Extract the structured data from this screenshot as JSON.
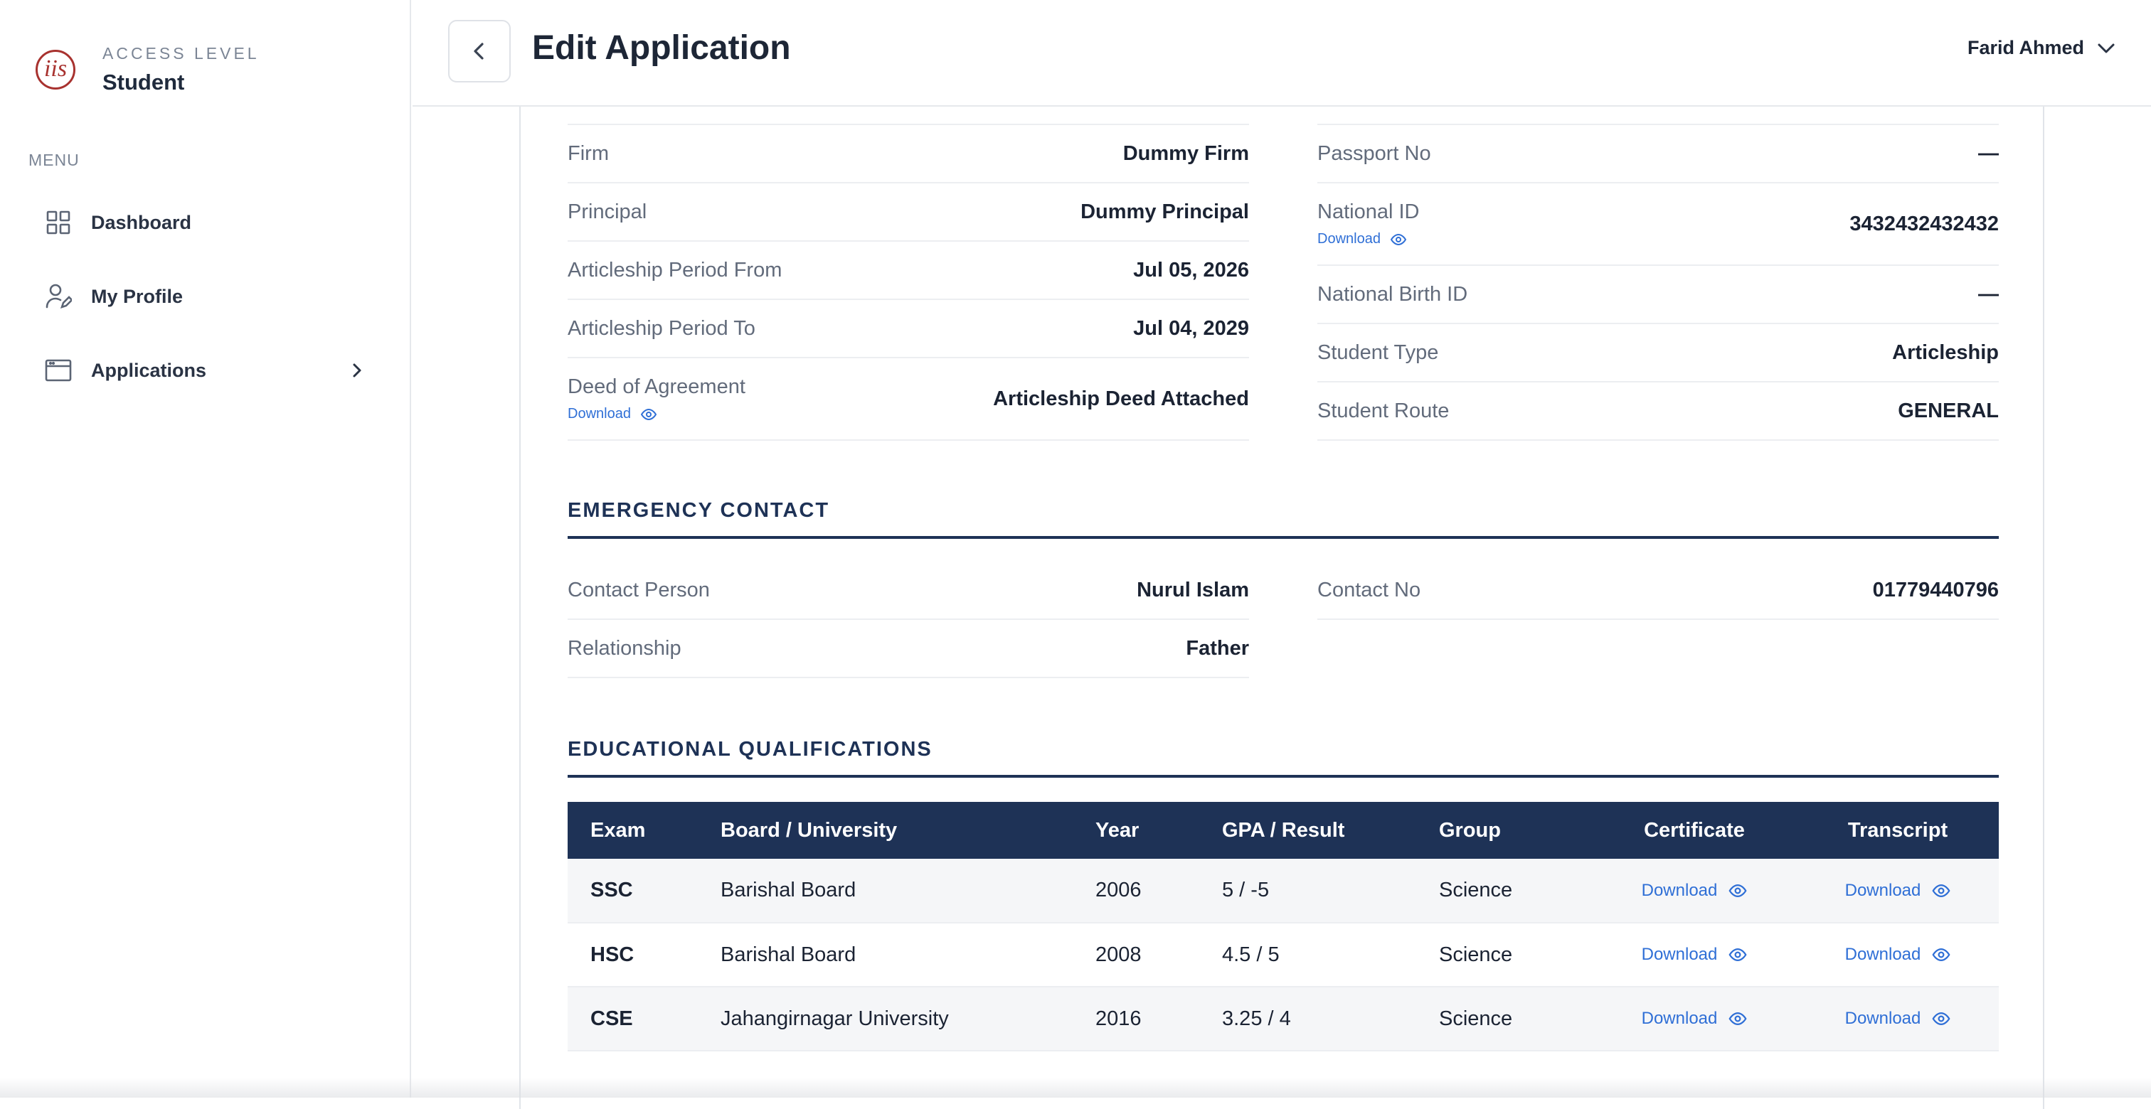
{
  "sidebar": {
    "logo_text": "iis",
    "access_label": "ACCESS LEVEL",
    "access_value": "Student",
    "menu_label": "MENU",
    "items": [
      {
        "label": "Dashboard",
        "icon": "grid-icon"
      },
      {
        "label": "My Profile",
        "icon": "user-edit-icon"
      },
      {
        "label": "Applications",
        "icon": "window-icon",
        "has_submenu": true
      }
    ]
  },
  "header": {
    "title": "Edit Application",
    "user_name": "Farid Ahmed"
  },
  "details_left": [
    {
      "label": "Firm",
      "value": "Dummy Firm"
    },
    {
      "label": "Principal",
      "value": "Dummy Principal"
    },
    {
      "label": "Articleship Period From",
      "value": "Jul 05, 2026"
    },
    {
      "label": "Articleship Period To",
      "value": "Jul 04, 2029"
    },
    {
      "label": "Deed of Agreement",
      "value": "Articleship Deed Attached",
      "download": "Download"
    }
  ],
  "details_right": [
    {
      "label": "Passport No",
      "value": "—"
    },
    {
      "label": "National ID",
      "value": "3432432432432",
      "download": "Download"
    },
    {
      "label": "National Birth ID",
      "value": "—"
    },
    {
      "label": "Student Type",
      "value": "Articleship"
    },
    {
      "label": "Student Route",
      "value": "GENERAL"
    }
  ],
  "emergency": {
    "title": "EMERGENCY CONTACT",
    "contact_person_label": "Contact Person",
    "contact_person": "Nurul Islam",
    "relationship_label": "Relationship",
    "relationship": "Father",
    "contact_no_label": "Contact No",
    "contact_no": "01779440796"
  },
  "education": {
    "title": "EDUCATIONAL QUALIFICATIONS",
    "columns": [
      "Exam",
      "Board / University",
      "Year",
      "GPA / Result",
      "Group",
      "Certificate",
      "Transcript"
    ],
    "rows": [
      {
        "exam": "SSC",
        "board": "Barishal Board",
        "year": "2006",
        "result": "5 / -5",
        "group": "Science",
        "certificate": "Download",
        "transcript": "Download"
      },
      {
        "exam": "HSC",
        "board": "Barishal Board",
        "year": "2008",
        "result": "4.5 / 5",
        "group": "Science",
        "certificate": "Download",
        "transcript": "Download"
      },
      {
        "exam": "CSE",
        "board": "Jahangirnagar University",
        "year": "2016",
        "result": "3.25 / 4",
        "group": "Science",
        "certificate": "Download",
        "transcript": "Download"
      }
    ]
  },
  "colors": {
    "navy": "#1e3256",
    "link": "#2f6fd6",
    "logo": "#a8322f"
  }
}
